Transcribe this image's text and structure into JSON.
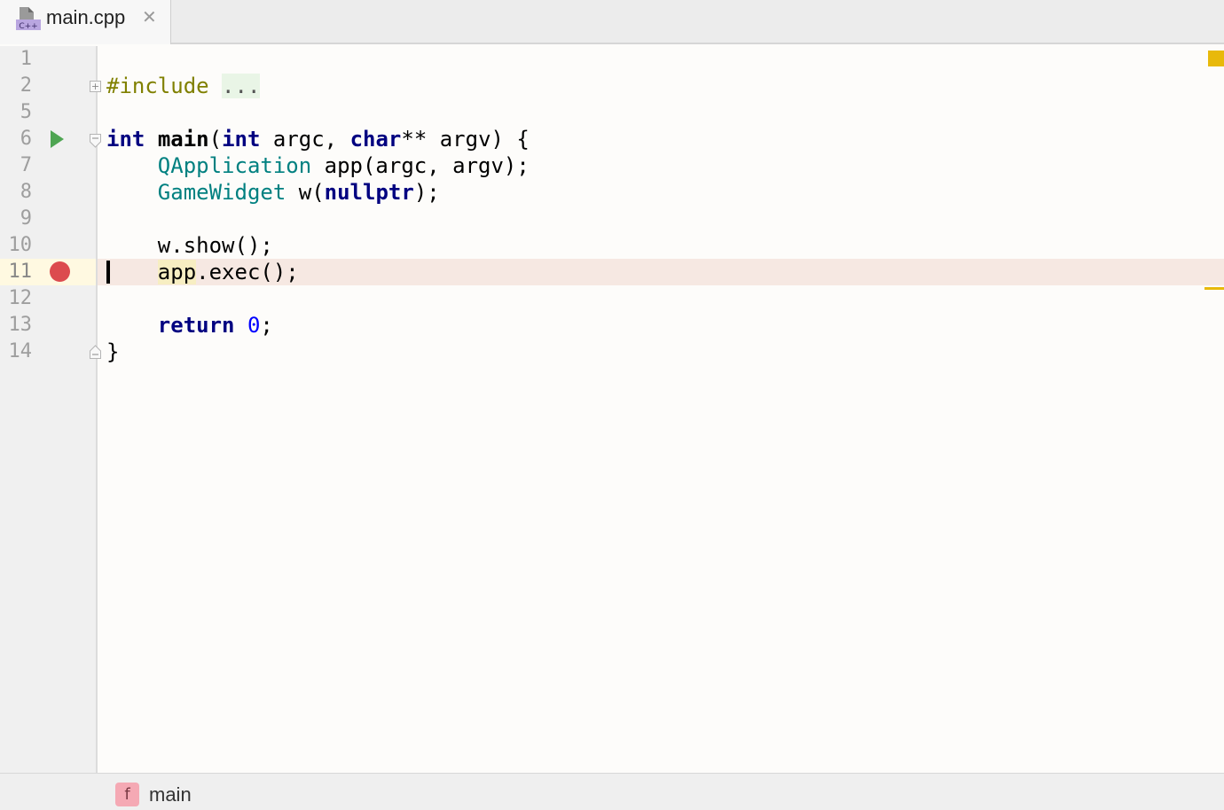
{
  "tab": {
    "label": "main.cpp",
    "icon_name": "cpp-file-icon",
    "icon_text": "C++",
    "close_glyph": "✕"
  },
  "gutter": {
    "line_numbers": [
      "1",
      "2",
      "5",
      "6",
      "7",
      "8",
      "9",
      "10",
      "11",
      "12",
      "13",
      "14"
    ],
    "current_line": "11",
    "run_line": "6",
    "breakpoint_line": "11"
  },
  "code": {
    "line_1": "",
    "line_2": {
      "directive": "#include",
      "folded": "..."
    },
    "line_6": {
      "kw_int": "int",
      "fn": "main",
      "open_paren": "(",
      "kw_int2": "int",
      "argc": " argc, ",
      "kw_char": "char",
      "rest": "** argv) {"
    },
    "line_7": {
      "indent": "    ",
      "type": "QApplication",
      "rest": " app(argc, argv);"
    },
    "line_8": {
      "indent": "    ",
      "type": "GameWidget",
      "mid": " w(",
      "kw": "nullptr",
      "rest": ");"
    },
    "line_10": {
      "indent": "    ",
      "text": "w.show();"
    },
    "line_11": {
      "indent": "    ",
      "app": "app",
      "rest": ".exec();"
    },
    "line_13": {
      "indent": "    ",
      "kw": "return",
      "space": " ",
      "num": "0",
      "rest": ";"
    },
    "line_14": "}"
  },
  "colors": {
    "keyword": "#000080",
    "type": "#008080",
    "number": "#0000ff",
    "preprocessor": "#808000",
    "breakpoint": "#dc4b4e",
    "run": "#4ea552",
    "warning": "#e8b90a"
  },
  "breadcrumb": {
    "badge": "f",
    "label": "main"
  }
}
